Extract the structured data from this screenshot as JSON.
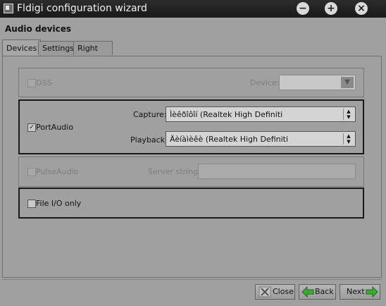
{
  "window": {
    "title": "Fldigi configuration wizard",
    "controls": {
      "minimize": "−",
      "maximize": "+",
      "close": "×"
    }
  },
  "header": {
    "title": "Audio devices"
  },
  "tabs": [
    {
      "label": "Devices",
      "active": true
    },
    {
      "label": "Settings",
      "active": false
    },
    {
      "label": "Right channel",
      "active": false
    }
  ],
  "oss": {
    "checkbox_label": "OSS",
    "checked": false,
    "enabled": false,
    "device_label": "Device:",
    "device_value": ""
  },
  "portaudio": {
    "checkbox_label": "PortAudio",
    "checked": true,
    "capture_label": "Capture:",
    "capture_value": "Ìèêðîôîí (Realtek High Definiti",
    "playback_label": "Playback:",
    "playback_value": "Äèíàìèêè (Realtek High Definiti"
  },
  "pulseaudio": {
    "checkbox_label": "PulseAudio",
    "checked": false,
    "enabled": false,
    "server_label": "Server string:",
    "server_value": ""
  },
  "fileio": {
    "checkbox_label": "File I/O only",
    "checked": false
  },
  "buttons": {
    "close": "Close",
    "back": "Back",
    "next": "Next"
  },
  "icons": {
    "close": "x-icon",
    "back": "green-left-arrow-icon",
    "next": "green-right-arrow-icon"
  },
  "colors": {
    "accent_green": "#3fa83a",
    "window_bg": "#a0a0a0",
    "titlebar_bg": "#1f1f1f"
  }
}
